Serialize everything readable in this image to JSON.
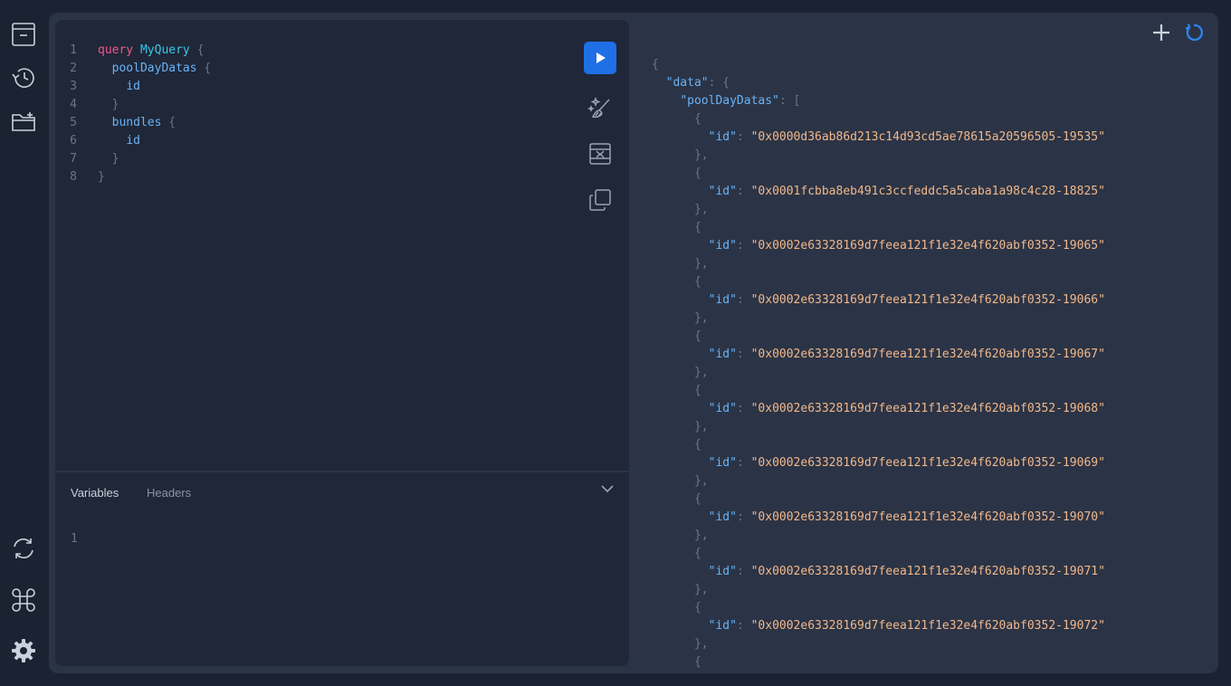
{
  "sidebar": {
    "top_icons": [
      "docs-icon",
      "history-icon",
      "add-folder-icon"
    ],
    "bottom_icons": [
      "refetch-schema-icon",
      "shortcuts-icon",
      "settings-icon"
    ]
  },
  "editor": {
    "query_keyword": "query",
    "operation_name": "MyQuery",
    "line_numbers": [
      "1",
      "2",
      "3",
      "4",
      "5",
      "6",
      "7",
      "8"
    ],
    "field_pool_day_datas": "poolDayDatas",
    "field_id_1": "id",
    "field_bundles": "bundles",
    "field_id_2": "id",
    "open_brace": "{",
    "close_brace": "}"
  },
  "variables": {
    "tab_variables": "Variables",
    "tab_headers": "Headers",
    "line_number": "1"
  },
  "result": {
    "open_brace": "{",
    "data_key": "\"data\"",
    "pool_day_datas_key": "\"poolDayDatas\"",
    "id_key": "\"id\"",
    "ids": [
      "\"0x0000d36ab86d213c14d93cd5ae78615a20596505-19535\"",
      "\"0x0001fcbba8eb491c3ccfeddc5a5caba1a98c4c28-18825\"",
      "\"0x0002e63328169d7feea121f1e32e4f620abf0352-19065\"",
      "\"0x0002e63328169d7feea121f1e32e4f620abf0352-19066\"",
      "\"0x0002e63328169d7feea121f1e32e4f620abf0352-19067\"",
      "\"0x0002e63328169d7feea121f1e32e4f620abf0352-19068\"",
      "\"0x0002e63328169d7feea121f1e32e4f620abf0352-19069\"",
      "\"0x0002e63328169d7feea121f1e32e4f620abf0352-19070\"",
      "\"0x0002e63328169d7feea121f1e32e4f620abf0352-19071\"",
      "\"0x0002e63328169d7feea121f1e32e4f620abf0352-19072\""
    ]
  },
  "colors": {
    "accent": "#1f6fe6",
    "keyword": "#f2568a",
    "operation": "#39c8e8",
    "field": "#6ab3f5",
    "string": "#f2b78a"
  }
}
